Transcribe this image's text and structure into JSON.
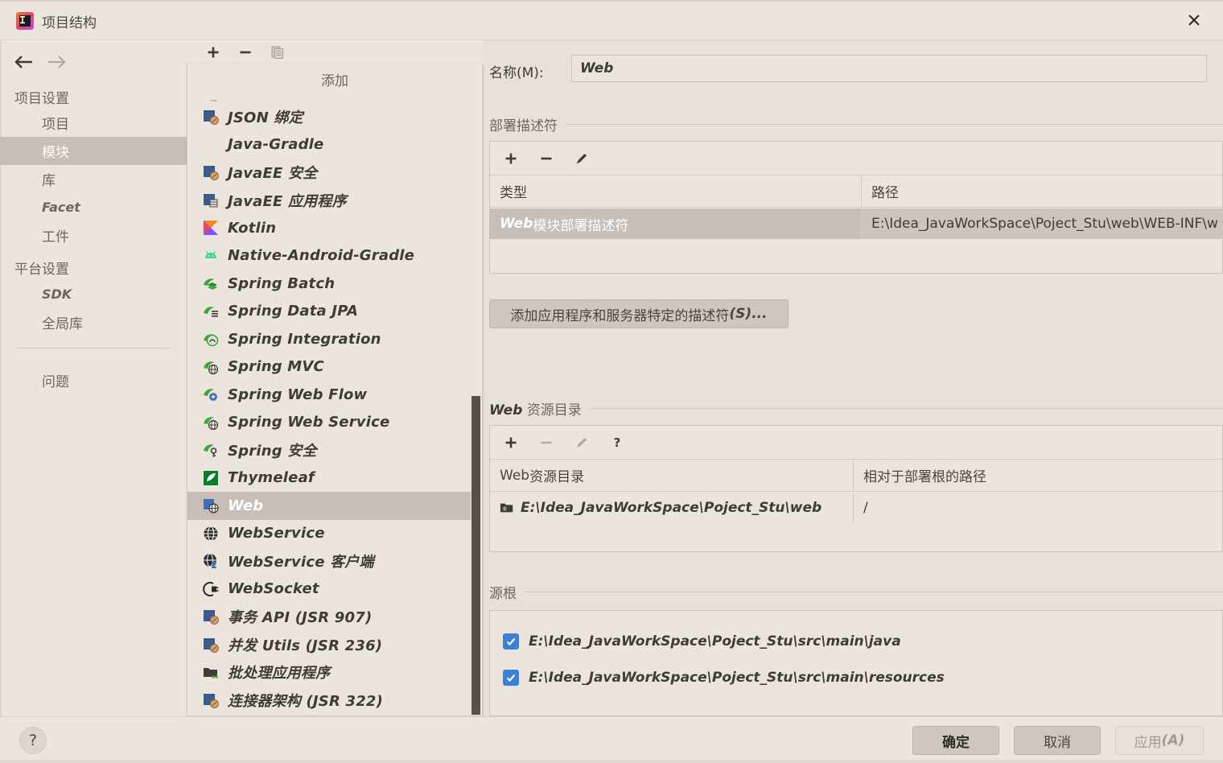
{
  "window": {
    "title": "项目结构",
    "app_icon": "intellij-idea-icon",
    "close_label": "✕"
  },
  "sidebar": {
    "back_icon": "arrow-left-icon",
    "forward_icon": "arrow-right-icon",
    "groups": [
      {
        "title": "项目设置",
        "items": [
          {
            "label": "项目",
            "italic": false,
            "selected": false
          },
          {
            "label": "模块",
            "italic": false,
            "selected": true
          },
          {
            "label": "库",
            "italic": false,
            "selected": false
          },
          {
            "label": "Facet",
            "italic": true,
            "selected": false
          },
          {
            "label": "工件",
            "italic": false,
            "selected": false
          }
        ]
      },
      {
        "title": "平台设置",
        "items": [
          {
            "label": "SDK",
            "italic": true,
            "selected": false
          },
          {
            "label": "全局库",
            "italic": false,
            "selected": false
          }
        ]
      }
    ],
    "problems": {
      "label": "问题"
    }
  },
  "module_toolbar": {
    "add_icon": "plus-icon",
    "remove_icon": "minus-icon",
    "copy_icon": "copy-icon"
  },
  "popup": {
    "header": "添加",
    "items": [
      {
        "label": "JSON 绑定",
        "icon": "javaee-json-icon"
      },
      {
        "label": "Java-Gradle",
        "icon": "none"
      },
      {
        "label": "JavaEE 安全",
        "icon": "javaee-security-icon"
      },
      {
        "label": "JavaEE 应用程序",
        "icon": "javaee-app-icon"
      },
      {
        "label": "Kotlin",
        "icon": "kotlin-icon"
      },
      {
        "label": "Native-Android-Gradle",
        "icon": "android-icon"
      },
      {
        "label": "Spring Batch",
        "icon": "spring-batch-icon"
      },
      {
        "label": "Spring Data JPA",
        "icon": "spring-data-jpa-icon"
      },
      {
        "label": "Spring Integration",
        "icon": "spring-integration-icon"
      },
      {
        "label": "Spring MVC",
        "icon": "spring-mvc-icon"
      },
      {
        "label": "Spring Web Flow",
        "icon": "spring-webflow-icon"
      },
      {
        "label": "Spring Web Service",
        "icon": "spring-webservice-icon"
      },
      {
        "label": "Spring 安全",
        "icon": "spring-security-icon"
      },
      {
        "label": "Thymeleaf",
        "icon": "thymeleaf-icon"
      },
      {
        "label": "Web",
        "icon": "web-icon",
        "selected": true
      },
      {
        "label": "WebService",
        "icon": "webservice-icon"
      },
      {
        "label": "WebService 客户端",
        "icon": "webservice-client-icon"
      },
      {
        "label": "WebSocket",
        "icon": "websocket-icon"
      },
      {
        "label": "事务 API (JSR 907)",
        "icon": "javaee-jta-icon"
      },
      {
        "label": "并发 Utils (JSR 236)",
        "icon": "javaee-concurrency-icon"
      },
      {
        "label": "批处理应用程序",
        "icon": "batch-app-icon"
      },
      {
        "label": "连接器架构 (JSR 322)",
        "icon": "javaee-connector-icon"
      }
    ]
  },
  "main": {
    "name_label": "名称(M):",
    "name_value": "Web",
    "deployment": {
      "section_title": "部署描述符",
      "toolbar": {
        "add_icon": "plus-icon",
        "remove_icon": "minus-icon",
        "edit_icon": "pencil-icon"
      },
      "columns": [
        "类型",
        "路径"
      ],
      "rows": [
        {
          "type_italic": "Web",
          "type_rest": " 模块部署描述符",
          "path": "E:\\Idea_JavaWorkSpace\\Poject_Stu\\web\\WEB-INF\\w",
          "selected": true
        }
      ],
      "add_descriptor_button": {
        "prefix": "添加应用程序和服务器特定的描述符",
        "suffix": "(S)..."
      }
    },
    "web_resource": {
      "section_title_italic": "Web",
      "section_title_rest": " 资源目录",
      "toolbar": {
        "add_icon": "plus-icon",
        "remove_icon": "minus-icon",
        "edit_icon": "pencil-icon",
        "help_icon": "question-icon"
      },
      "columns_italic": "Web",
      "columns_rest": " 资源目录",
      "column2": "相对于部署根的路径",
      "rows": [
        {
          "icon": "folder-web-icon",
          "dir": "E:\\Idea_JavaWorkSpace\\Poject_Stu\\web",
          "relative": "/"
        }
      ]
    },
    "source_roots": {
      "section_title": "源根",
      "items": [
        {
          "checked": true,
          "path": "E:\\Idea_JavaWorkSpace\\Poject_Stu\\src\\main\\java"
        },
        {
          "checked": true,
          "path": "E:\\Idea_JavaWorkSpace\\Poject_Stu\\src\\main\\resources"
        }
      ]
    }
  },
  "footer": {
    "help_icon": "question-icon",
    "ok": "确定",
    "cancel": "取消",
    "apply_prefix": "应用",
    "apply_suffix": "(A)"
  },
  "colors": {
    "background": "#e8e1d9",
    "panel": "#ece5dd",
    "selection": "#c6beb7",
    "border": "#cbc3b9",
    "text": "#3f3b36",
    "text_muted": "#6d675f",
    "checkbox_blue": "#3c7fd6",
    "scrollbar": "#555049"
  }
}
